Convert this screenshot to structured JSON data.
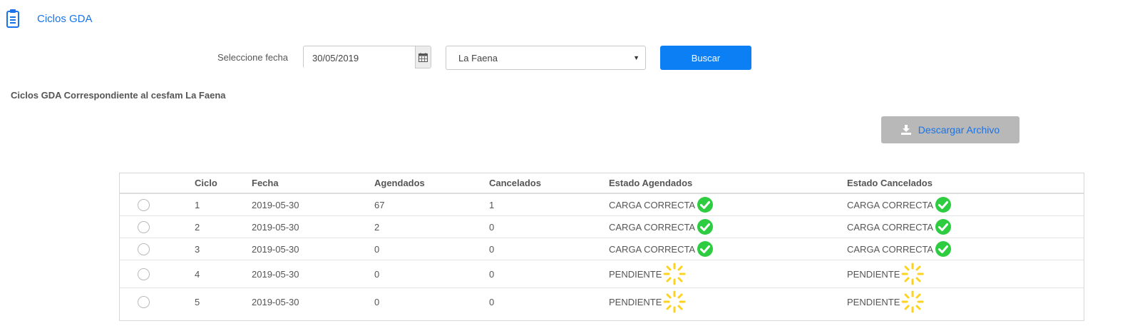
{
  "header": {
    "title": "Ciclos GDA",
    "icon": "clipboard-icon",
    "icon_color": "#1a73e8"
  },
  "filters": {
    "fecha_label": "Seleccione fecha",
    "fecha_value": "30/05/2019",
    "cesfam_selected": "La Faena",
    "buscar_label": "Buscar",
    "buscar_color": "#0d7ff5"
  },
  "subtitle": "Ciclos GDA Correspondiente al cesfam La Faena",
  "download": {
    "label": "Descargar Archivo",
    "icon": "download-icon"
  },
  "table": {
    "headers": {
      "ciclo": "Ciclo",
      "fecha": "Fecha",
      "agendados": "Agendados",
      "cancelados": "Cancelados",
      "estado_agendados": "Estado Agendados",
      "estado_cancelados": "Estado Cancelados"
    },
    "rows": [
      {
        "ciclo": "1",
        "fecha": "2019-05-30",
        "agendados": "67",
        "cancelados": "1",
        "estado_agendados": "CARGA CORRECTA",
        "estado_cancelados": "CARGA CORRECTA"
      },
      {
        "ciclo": "2",
        "fecha": "2019-05-30",
        "agendados": "2",
        "cancelados": "0",
        "estado_agendados": "CARGA CORRECTA",
        "estado_cancelados": "CARGA CORRECTA"
      },
      {
        "ciclo": "3",
        "fecha": "2019-05-30",
        "agendados": "0",
        "cancelados": "0",
        "estado_agendados": "CARGA CORRECTA",
        "estado_cancelados": "CARGA CORRECTA"
      },
      {
        "ciclo": "4",
        "fecha": "2019-05-30",
        "agendados": "0",
        "cancelados": "0",
        "estado_agendados": "PENDIENTE",
        "estado_cancelados": "PENDIENTE"
      },
      {
        "ciclo": "5",
        "fecha": "2019-05-30",
        "agendados": "0",
        "cancelados": "0",
        "estado_agendados": "PENDIENTE",
        "estado_cancelados": "PENDIENTE"
      }
    ]
  },
  "colors": {
    "ok": "#2ecc40",
    "pending": "#ffd21f"
  }
}
